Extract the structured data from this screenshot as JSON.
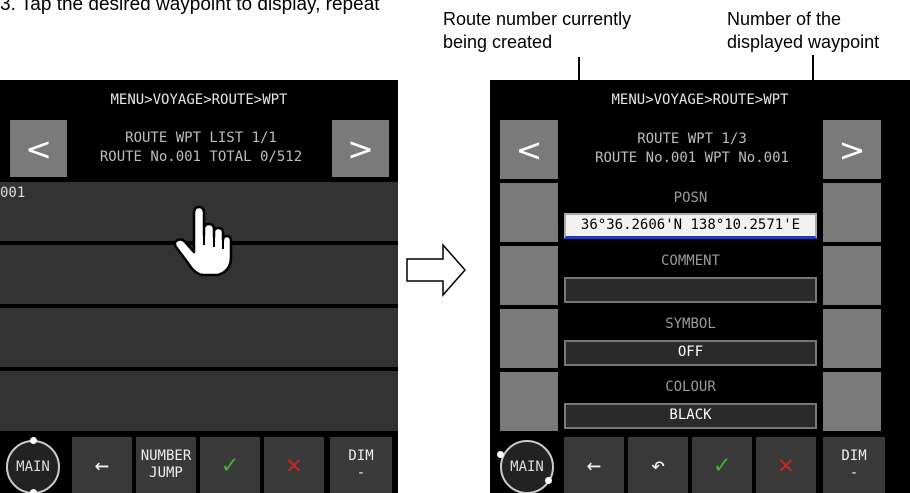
{
  "intro_text": "3. Tap the desired waypoint to display, repeat",
  "annotations": {
    "route_number": [
      "Route number currently",
      "being created"
    ],
    "waypoint_number": [
      "Number of the",
      "displayed waypoint"
    ]
  },
  "left_screen": {
    "breadcrumb": "MENU>VOYAGE>ROUTE>WPT",
    "prev": "<",
    "next": ">",
    "header_line1": "ROUTE WPT LIST 1/1",
    "header_line2": "ROUTE No.001 TOTAL 0/512",
    "rows": [
      "001",
      "",
      "",
      ""
    ],
    "toolbar": {
      "main": "MAIN",
      "back": "←",
      "number_jump_1": "NUMBER",
      "number_jump_2": "JUMP",
      "ok": "✓",
      "cancel": "✕",
      "dim": "DIM",
      "dim_value": "-"
    }
  },
  "right_screen": {
    "breadcrumb": "MENU>VOYAGE>ROUTE>WPT",
    "prev": "<",
    "next": ">",
    "header_line1": "ROUTE WPT 1/3",
    "header_line2": "ROUTE No.001 WPT No.001",
    "fields": {
      "posn_label": "POSN",
      "posn_value": "36°36.2606'N 138°10.2571'E",
      "comment_label": "COMMENT",
      "comment_value": "",
      "symbol_label": "SYMBOL",
      "symbol_value": "OFF",
      "colour_label": "COLOUR",
      "colour_value": "BLACK"
    },
    "toolbar": {
      "main": "MAIN",
      "back": "←",
      "undo": "↶",
      "ok": "✓",
      "cancel": "✕",
      "dim": "DIM",
      "dim_value": "-"
    }
  },
  "colors": {
    "screen_bg": "#000000",
    "button_gray": "#7a7a7a",
    "row_bg": "#333333",
    "ok_green": "#3fae3a",
    "cancel_red": "#c62828",
    "active_underline": "#1e3cb4"
  }
}
